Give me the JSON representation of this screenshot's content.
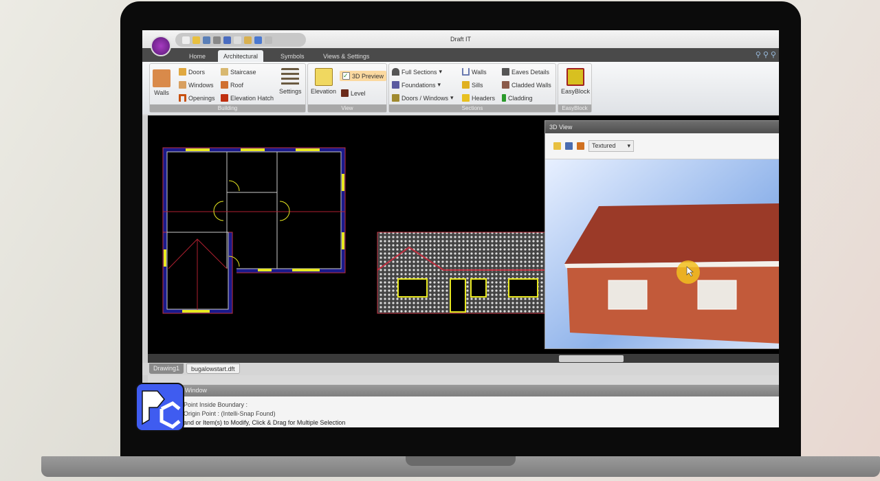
{
  "window": {
    "title": "Draft IT"
  },
  "tabs": [
    "Home",
    "Architectural",
    "Symbols",
    "Views & Settings"
  ],
  "active_tab": "Architectural",
  "ribbon": {
    "building": {
      "label": "Building",
      "walls": "Walls",
      "doors": "Doors",
      "windows": "Windows",
      "openings": "Openings",
      "staircase": "Staircase",
      "roof": "Roof",
      "elevation_hatch": "Elevation Hatch",
      "settings": "Settings"
    },
    "view": {
      "label": "View",
      "elevation": "Elevation",
      "preview3d": "3D Preview",
      "preview3d_checked": true,
      "level": "Level"
    },
    "sections": {
      "label": "Sections",
      "full_sections": "Full Sections",
      "foundations": "Foundations",
      "doors_windows": "Doors / Windows",
      "walls": "Walls",
      "sills": "Sills",
      "headers": "Headers",
      "eaves_details": "Eaves Details",
      "cladded_walls": "Cladded Walls",
      "cladding": "Cladding"
    },
    "easyblock": {
      "label": "EasyBlock",
      "button": "EasyBlock"
    }
  },
  "view3d": {
    "title": "3D View",
    "render_mode": "Textured"
  },
  "doc_tabs": [
    "Drawing1",
    "bugalowstart.dft"
  ],
  "command": {
    "title": "Window",
    "lines": [
      "Point Inside Boundary :",
      "Origin Point :  (Intelli-Snap Found)",
      "and or Item(s) to Modify, Click & Drag for Multiple Selection"
    ]
  }
}
